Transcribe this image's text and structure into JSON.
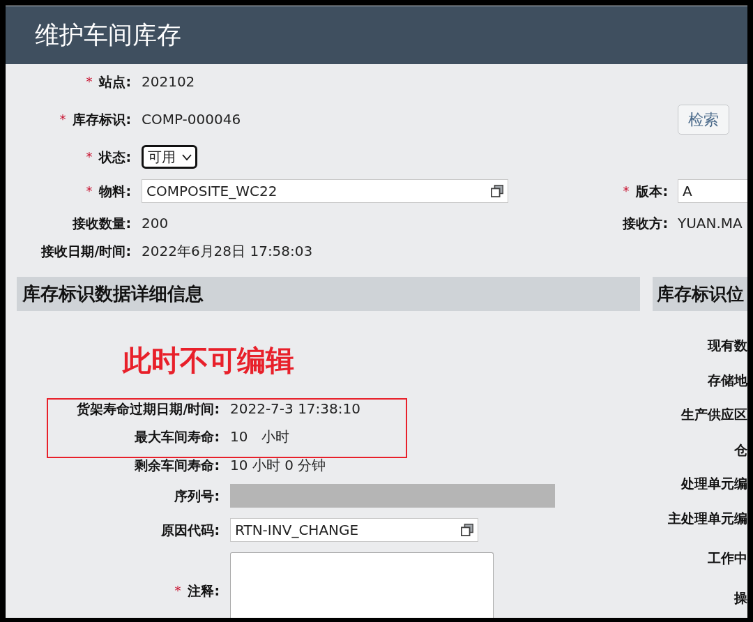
{
  "window": {
    "title": "维护车间库存"
  },
  "form": {
    "rows": [
      {
        "left": {
          "kind": "text",
          "marker": "*",
          "label": "站点:",
          "value": "202102"
        }
      },
      {
        "left": {
          "kind": "text",
          "marker": "*",
          "label": "库存标识:",
          "value": "COMP-000046"
        },
        "right": {
          "kind": "button",
          "label": "检索"
        }
      },
      {
        "left": {
          "kind": "select",
          "marker": "*",
          "label": "状态:",
          "value": "可用",
          "focused": true
        }
      },
      {
        "left": {
          "kind": "lookup",
          "marker": "*",
          "label": "物料:",
          "value": "COMPOSITE_WC22",
          "disabled": false
        },
        "right": {
          "kind": "input",
          "marker": "*",
          "label": "版本:",
          "value": "A",
          "disabled": false
        }
      },
      {
        "left": {
          "kind": "text",
          "label": "接收数量:",
          "value": "200"
        },
        "right": {
          "kind": "text",
          "label": "接收方:",
          "value": "YUAN.MA"
        }
      },
      {
        "left": {
          "kind": "text",
          "label": "接收日期/时间:",
          "value": "2022年6月28日 17:58:03"
        }
      }
    ]
  },
  "details": {
    "title": "库存标识数据详细信息",
    "annotation": "此时不可编辑",
    "highlighted_fields": [
      {
        "kind": "text",
        "label": "货架寿命过期日期/时间:",
        "value": "2022-7-3 17:38:10"
      },
      {
        "kind": "text",
        "label": "最大车间寿命:",
        "value": "10",
        "unit": "小时"
      }
    ],
    "fields": [
      {
        "kind": "text",
        "label": "剩余车间寿命:",
        "value": "10 小时 0 分钟"
      },
      {
        "kind": "input",
        "label": "序列号:",
        "disabled": true
      },
      {
        "kind": "lookup",
        "label": "原因代码:",
        "value": "RTN-INV_CHANGE",
        "disabled": false
      },
      {
        "kind": "textarea",
        "marker": "*",
        "label": "注释:"
      }
    ]
  },
  "location": {
    "title": "库存标识位",
    "labels": [
      "现有数",
      "存储地",
      "生产供应区",
      "仓",
      "处理单元编",
      "主处理单元编",
      "工作中",
      "操"
    ]
  }
}
